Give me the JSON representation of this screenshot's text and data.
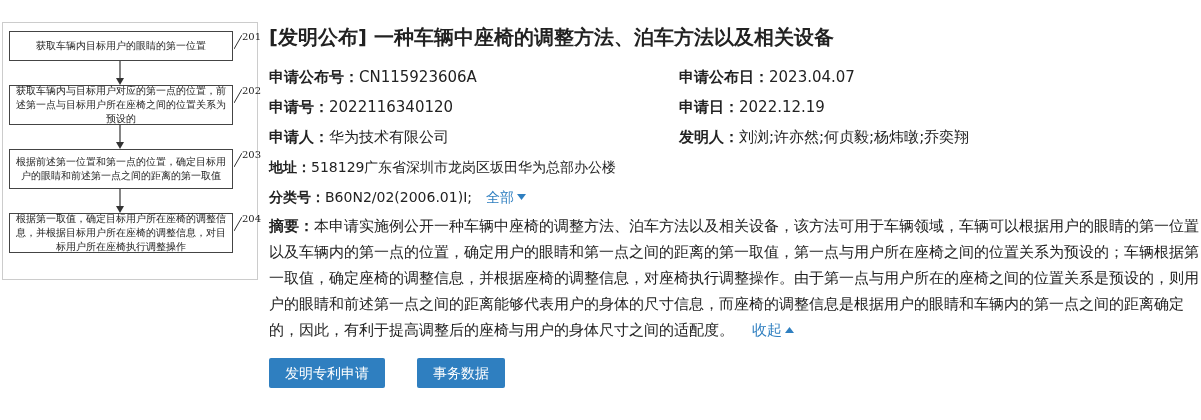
{
  "figure": {
    "steps": [
      {
        "text": "获取车辆内目标用户的眼睛的第一位置",
        "number": "201"
      },
      {
        "text": "获取车辆内与目标用户对应的第一点的位置，前述第一点与目标用户所在座椅之间的位置关系为预设的",
        "number": "202"
      },
      {
        "text": "根据前述第一位置和第一点的位置，确定目标用户的眼睛和前述第一点之间的距离的第一取值",
        "number": "203"
      },
      {
        "text": "根据第一取值，确定目标用户所在座椅的调整信息，并根据目标用户所在座椅的调整信息，对目标用户所在座椅执行调整操作",
        "number": "204"
      }
    ]
  },
  "title": "[发明公布] 一种车辆中座椅的调整方法、泊车方法以及相关设备",
  "fields": [
    {
      "label": "申请公布号：",
      "value": "CN115923606A"
    },
    {
      "label": "申请公布日：",
      "value": "2023.04.07"
    },
    {
      "label": "申请号：",
      "value": "2022116340120"
    },
    {
      "label": "申请日：",
      "value": "2022.12.19"
    },
    {
      "label": "申请人：",
      "value": "华为技术有限公司"
    },
    {
      "label": "发明人：",
      "value": "刘浏;许亦然;何贞毅;杨炜暾;乔奕翔"
    }
  ],
  "address": {
    "label": "地址：",
    "value": "518129广东省深圳市龙岗区坂田华为总部办公楼"
  },
  "classification": {
    "label": "分类号：",
    "value": "B60N2/02(2006.01)I;",
    "link": "全部"
  },
  "abstract": {
    "label": "摘要：",
    "text": "本申请实施例公开一种车辆中座椅的调整方法、泊车方法以及相关设备，该方法可用于车辆领域，车辆可以根据用户的眼睛的第一位置以及车辆内的第一点的位置，确定用户的眼睛和第一点之间的距离的第一取值，第一点与用户所在座椅之间的位置关系为预设的；车辆根据第一取值，确定座椅的调整信息，并根据座椅的调整信息，对座椅执行调整操作。由于第一点与用户所在的座椅之间的位置关系是预设的，则用户的眼睛和前述第一点之间的距离能够代表用户的身体的尺寸信息，而座椅的调整信息是根据用户的眼睛和车辆内的第一点之间的距离确定的，因此，有利于提高调整后的座椅与用户的身体尺寸之间的适配度。",
    "link": "收起"
  },
  "buttons": [
    "发明专利申请",
    "事务数据"
  ]
}
